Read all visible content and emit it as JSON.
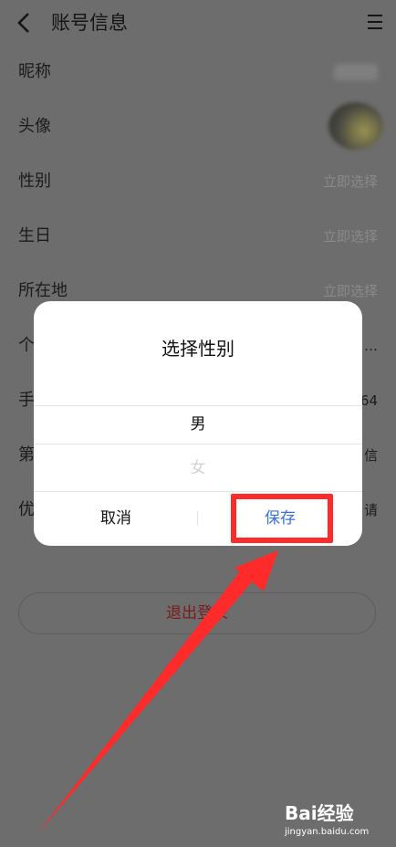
{
  "header": {
    "title": "账号信息"
  },
  "rows": [
    {
      "label": "昵称",
      "value": ""
    },
    {
      "label": "头像",
      "value": ""
    },
    {
      "label": "性别",
      "value": "立即选择"
    },
    {
      "label": "生日",
      "value": "立即选择"
    },
    {
      "label": "所在地",
      "value": "立即选择"
    },
    {
      "label": "个",
      "value": "…"
    },
    {
      "label": "手",
      "value": "64"
    },
    {
      "label": "第",
      "value": "信"
    },
    {
      "label": "优",
      "value": "请"
    }
  ],
  "logout": {
    "label": "退出登录"
  },
  "dialog": {
    "title": "选择性别",
    "options": [
      "男",
      "女"
    ],
    "cancel_label": "取消",
    "save_label": "保存"
  },
  "watermark": {
    "logo_text": "Bai经验",
    "url": "jingyan.baidu.com"
  },
  "colors": {
    "overlay": "#6d6d6d",
    "highlight": "#ff2a2a",
    "save_text": "#3a6fdc",
    "logout_text": "#7b1a1a"
  }
}
